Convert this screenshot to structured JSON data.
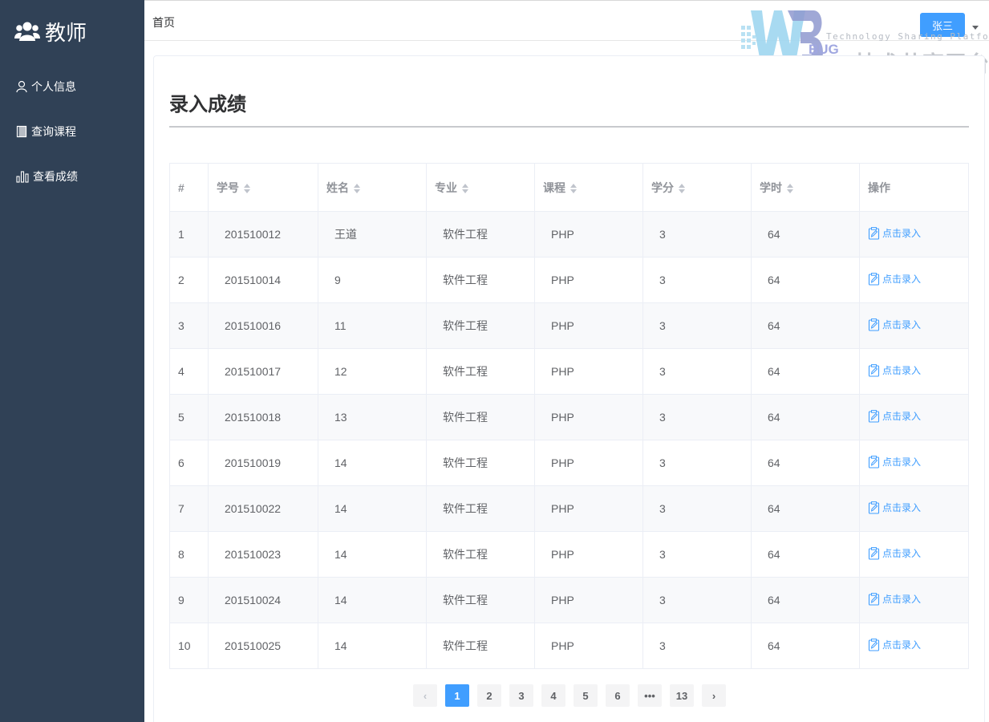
{
  "sidebar": {
    "brand": "教师",
    "items": [
      {
        "label": "个人信息",
        "icon": "user-icon"
      },
      {
        "label": "查询课程",
        "icon": "book-icon"
      },
      {
        "label": "查看成绩",
        "icon": "bar-chart-icon"
      }
    ]
  },
  "header": {
    "breadcrumb": "首页",
    "user_button": "张三"
  },
  "watermark": {
    "tagline": "Technology Sharing Platform",
    "cn_text": "技术共享平台",
    "bug": "BUG",
    "write": "WRITE"
  },
  "main": {
    "title": "录入成绩",
    "columns": [
      "#",
      "学号",
      "姓名",
      "专业",
      "课程",
      "学分",
      "学时",
      "操作"
    ],
    "rows": [
      {
        "idx": "1",
        "id": "201510012",
        "name": "王道",
        "major": "软件工程",
        "course": "PHP",
        "credit": "3",
        "hours": "64",
        "action": "点击录入"
      },
      {
        "idx": "2",
        "id": "201510014",
        "name": "9",
        "major": "软件工程",
        "course": "PHP",
        "credit": "3",
        "hours": "64",
        "action": "点击录入"
      },
      {
        "idx": "3",
        "id": "201510016",
        "name": "11",
        "major": "软件工程",
        "course": "PHP",
        "credit": "3",
        "hours": "64",
        "action": "点击录入"
      },
      {
        "idx": "4",
        "id": "201510017",
        "name": "12",
        "major": "软件工程",
        "course": "PHP",
        "credit": "3",
        "hours": "64",
        "action": "点击录入"
      },
      {
        "idx": "5",
        "id": "201510018",
        "name": "13",
        "major": "软件工程",
        "course": "PHP",
        "credit": "3",
        "hours": "64",
        "action": "点击录入"
      },
      {
        "idx": "6",
        "id": "201510019",
        "name": "14",
        "major": "软件工程",
        "course": "PHP",
        "credit": "3",
        "hours": "64",
        "action": "点击录入"
      },
      {
        "idx": "7",
        "id": "201510022",
        "name": "14",
        "major": "软件工程",
        "course": "PHP",
        "credit": "3",
        "hours": "64",
        "action": "点击录入"
      },
      {
        "idx": "8",
        "id": "201510023",
        "name": "14",
        "major": "软件工程",
        "course": "PHP",
        "credit": "3",
        "hours": "64",
        "action": "点击录入"
      },
      {
        "idx": "9",
        "id": "201510024",
        "name": "14",
        "major": "软件工程",
        "course": "PHP",
        "credit": "3",
        "hours": "64",
        "action": "点击录入"
      },
      {
        "idx": "10",
        "id": "201510025",
        "name": "14",
        "major": "软件工程",
        "course": "PHP",
        "credit": "3",
        "hours": "64",
        "action": "点击录入"
      }
    ]
  },
  "pagination": {
    "prev": "‹",
    "pages": [
      "1",
      "2",
      "3",
      "4",
      "5",
      "6",
      "•••",
      "13"
    ],
    "current": "1",
    "next": "›"
  },
  "colors": {
    "sidebar_bg": "#304156",
    "primary": "#409eff"
  }
}
